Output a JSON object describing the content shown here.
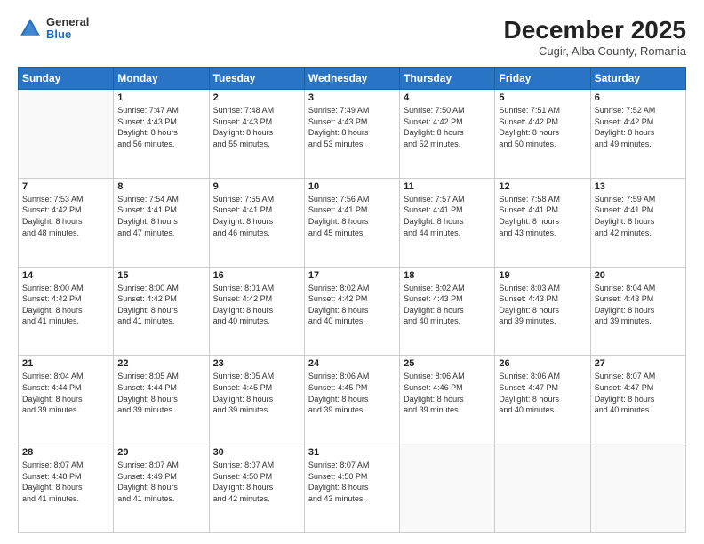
{
  "logo": {
    "general": "General",
    "blue": "Blue"
  },
  "header": {
    "title": "December 2025",
    "subtitle": "Cugir, Alba County, Romania"
  },
  "days_of_week": [
    "Sunday",
    "Monday",
    "Tuesday",
    "Wednesday",
    "Thursday",
    "Friday",
    "Saturday"
  ],
  "weeks": [
    [
      {
        "day": "",
        "info": ""
      },
      {
        "day": "1",
        "info": "Sunrise: 7:47 AM\nSunset: 4:43 PM\nDaylight: 8 hours\nand 56 minutes."
      },
      {
        "day": "2",
        "info": "Sunrise: 7:48 AM\nSunset: 4:43 PM\nDaylight: 8 hours\nand 55 minutes."
      },
      {
        "day": "3",
        "info": "Sunrise: 7:49 AM\nSunset: 4:43 PM\nDaylight: 8 hours\nand 53 minutes."
      },
      {
        "day": "4",
        "info": "Sunrise: 7:50 AM\nSunset: 4:42 PM\nDaylight: 8 hours\nand 52 minutes."
      },
      {
        "day": "5",
        "info": "Sunrise: 7:51 AM\nSunset: 4:42 PM\nDaylight: 8 hours\nand 50 minutes."
      },
      {
        "day": "6",
        "info": "Sunrise: 7:52 AM\nSunset: 4:42 PM\nDaylight: 8 hours\nand 49 minutes."
      }
    ],
    [
      {
        "day": "7",
        "info": "Sunrise: 7:53 AM\nSunset: 4:42 PM\nDaylight: 8 hours\nand 48 minutes."
      },
      {
        "day": "8",
        "info": "Sunrise: 7:54 AM\nSunset: 4:41 PM\nDaylight: 8 hours\nand 47 minutes."
      },
      {
        "day": "9",
        "info": "Sunrise: 7:55 AM\nSunset: 4:41 PM\nDaylight: 8 hours\nand 46 minutes."
      },
      {
        "day": "10",
        "info": "Sunrise: 7:56 AM\nSunset: 4:41 PM\nDaylight: 8 hours\nand 45 minutes."
      },
      {
        "day": "11",
        "info": "Sunrise: 7:57 AM\nSunset: 4:41 PM\nDaylight: 8 hours\nand 44 minutes."
      },
      {
        "day": "12",
        "info": "Sunrise: 7:58 AM\nSunset: 4:41 PM\nDaylight: 8 hours\nand 43 minutes."
      },
      {
        "day": "13",
        "info": "Sunrise: 7:59 AM\nSunset: 4:41 PM\nDaylight: 8 hours\nand 42 minutes."
      }
    ],
    [
      {
        "day": "14",
        "info": "Sunrise: 8:00 AM\nSunset: 4:42 PM\nDaylight: 8 hours\nand 41 minutes."
      },
      {
        "day": "15",
        "info": "Sunrise: 8:00 AM\nSunset: 4:42 PM\nDaylight: 8 hours\nand 41 minutes."
      },
      {
        "day": "16",
        "info": "Sunrise: 8:01 AM\nSunset: 4:42 PM\nDaylight: 8 hours\nand 40 minutes."
      },
      {
        "day": "17",
        "info": "Sunrise: 8:02 AM\nSunset: 4:42 PM\nDaylight: 8 hours\nand 40 minutes."
      },
      {
        "day": "18",
        "info": "Sunrise: 8:02 AM\nSunset: 4:43 PM\nDaylight: 8 hours\nand 40 minutes."
      },
      {
        "day": "19",
        "info": "Sunrise: 8:03 AM\nSunset: 4:43 PM\nDaylight: 8 hours\nand 39 minutes."
      },
      {
        "day": "20",
        "info": "Sunrise: 8:04 AM\nSunset: 4:43 PM\nDaylight: 8 hours\nand 39 minutes."
      }
    ],
    [
      {
        "day": "21",
        "info": "Sunrise: 8:04 AM\nSunset: 4:44 PM\nDaylight: 8 hours\nand 39 minutes."
      },
      {
        "day": "22",
        "info": "Sunrise: 8:05 AM\nSunset: 4:44 PM\nDaylight: 8 hours\nand 39 minutes."
      },
      {
        "day": "23",
        "info": "Sunrise: 8:05 AM\nSunset: 4:45 PM\nDaylight: 8 hours\nand 39 minutes."
      },
      {
        "day": "24",
        "info": "Sunrise: 8:06 AM\nSunset: 4:45 PM\nDaylight: 8 hours\nand 39 minutes."
      },
      {
        "day": "25",
        "info": "Sunrise: 8:06 AM\nSunset: 4:46 PM\nDaylight: 8 hours\nand 39 minutes."
      },
      {
        "day": "26",
        "info": "Sunrise: 8:06 AM\nSunset: 4:47 PM\nDaylight: 8 hours\nand 40 minutes."
      },
      {
        "day": "27",
        "info": "Sunrise: 8:07 AM\nSunset: 4:47 PM\nDaylight: 8 hours\nand 40 minutes."
      }
    ],
    [
      {
        "day": "28",
        "info": "Sunrise: 8:07 AM\nSunset: 4:48 PM\nDaylight: 8 hours\nand 41 minutes."
      },
      {
        "day": "29",
        "info": "Sunrise: 8:07 AM\nSunset: 4:49 PM\nDaylight: 8 hours\nand 41 minutes."
      },
      {
        "day": "30",
        "info": "Sunrise: 8:07 AM\nSunset: 4:50 PM\nDaylight: 8 hours\nand 42 minutes."
      },
      {
        "day": "31",
        "info": "Sunrise: 8:07 AM\nSunset: 4:50 PM\nDaylight: 8 hours\nand 43 minutes."
      },
      {
        "day": "",
        "info": ""
      },
      {
        "day": "",
        "info": ""
      },
      {
        "day": "",
        "info": ""
      }
    ]
  ]
}
